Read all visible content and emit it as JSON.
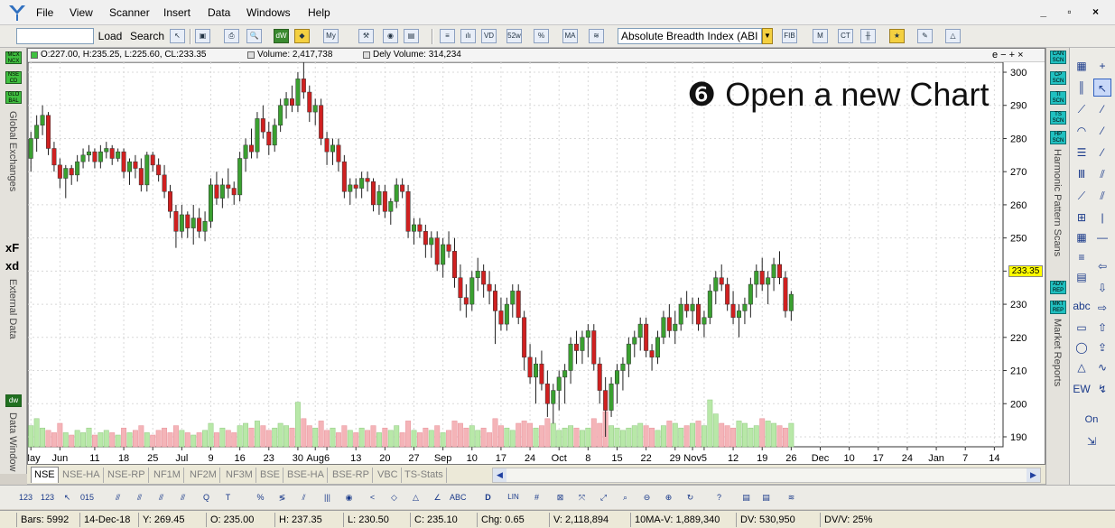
{
  "menu": {
    "items": [
      "File",
      "View",
      "Scanner",
      "Insert",
      "Data",
      "Windows",
      "Help"
    ],
    "window_controls": "_ ▫ ×"
  },
  "toolbar": {
    "load_label": "Load",
    "search_label": "Search",
    "indicator_value": "Absolute Breadth Index (ABI",
    "icons": [
      "auto-fibo",
      "pvt",
      "cow-tail",
      "star",
      "line-tools"
    ]
  },
  "left_panel": {
    "exchange_buttons": [
      "MCX NCX",
      "NSE CD",
      "GLO BAL"
    ],
    "global_exchanges_label": "Global Exchanges",
    "fx_label": "xF",
    "fd_label": "xd",
    "external_data_label": "External Data",
    "dw_button": "dw",
    "data_window_label": "Data Window"
  },
  "chart_header": {
    "ohlc": "O:227.00, H:235.25, L:225.60, CL:233.35",
    "volume": "Volume: 2,417,738",
    "dely_volume": "Dely Volume: 314,234",
    "controls": "e − + ×"
  },
  "overlay_title": "❻ Open a new Chart",
  "last_price_tag": "233.35",
  "chart_data": {
    "type": "candlestick",
    "y_axis_ticks": [
      300,
      290,
      280,
      270,
      260,
      250,
      240,
      230,
      220,
      210,
      200,
      190
    ],
    "ylim": [
      187,
      303
    ],
    "x_tick_labels": [
      {
        "label": "May",
        "i": 0
      },
      {
        "label": "Jun",
        "i": 5
      },
      {
        "label": "11",
        "i": 11
      },
      {
        "label": "18",
        "i": 16
      },
      {
        "label": "25",
        "i": 21
      },
      {
        "label": "Jul",
        "i": 26
      },
      {
        "label": "9",
        "i": 31
      },
      {
        "label": "16",
        "i": 36
      },
      {
        "label": "23",
        "i": 41
      },
      {
        "label": "30",
        "i": 46
      },
      {
        "label": "Aug",
        "i": 49
      },
      {
        "label": "6",
        "i": 51
      },
      {
        "label": "13",
        "i": 56
      },
      {
        "label": "20",
        "i": 61
      },
      {
        "label": "27",
        "i": 66
      },
      {
        "label": "Sep",
        "i": 71
      },
      {
        "label": "10",
        "i": 76
      },
      {
        "label": "17",
        "i": 81
      },
      {
        "label": "24",
        "i": 86
      },
      {
        "label": "Oct",
        "i": 91
      },
      {
        "label": "8",
        "i": 96
      },
      {
        "label": "15",
        "i": 101
      },
      {
        "label": "22",
        "i": 106
      },
      {
        "label": "29",
        "i": 111
      },
      {
        "label": "Nov",
        "i": 114
      },
      {
        "label": "5",
        "i": 116
      },
      {
        "label": "12",
        "i": 121
      },
      {
        "label": "19",
        "i": 126
      },
      {
        "label": "26",
        "i": 131
      },
      {
        "label": "Dec",
        "i": 136
      },
      {
        "label": "10",
        "i": 141
      },
      {
        "label": "17",
        "i": 146
      },
      {
        "label": "24",
        "i": 151
      },
      {
        "label": "Jan",
        "i": 156
      },
      {
        "label": "7",
        "i": 161
      },
      {
        "label": "14",
        "i": 166
      }
    ],
    "total_slots": 168,
    "candles": [
      [
        274,
        282,
        270,
        280
      ],
      [
        280,
        287,
        276,
        284
      ],
      [
        284,
        290,
        281,
        287
      ],
      [
        287,
        288,
        275,
        277
      ],
      [
        277,
        279,
        270,
        272
      ],
      [
        272,
        274,
        265,
        268
      ],
      [
        268,
        272,
        262,
        271
      ],
      [
        271,
        272,
        266,
        269
      ],
      [
        269,
        275,
        267,
        273
      ],
      [
        273,
        277,
        271,
        275
      ],
      [
        275,
        278,
        273,
        276
      ],
      [
        276,
        277,
        271,
        273
      ],
      [
        273,
        278,
        271,
        276
      ],
      [
        276,
        279,
        274,
        277
      ],
      [
        277,
        278,
        272,
        274
      ],
      [
        274,
        277,
        273,
        276
      ],
      [
        276,
        277,
        268,
        270
      ],
      [
        270,
        274,
        266,
        273
      ],
      [
        273,
        275,
        268,
        271
      ],
      [
        271,
        274,
        264,
        266
      ],
      [
        266,
        276,
        264,
        275
      ],
      [
        275,
        276,
        270,
        272
      ],
      [
        272,
        274,
        267,
        269
      ],
      [
        269,
        272,
        262,
        264
      ],
      [
        264,
        266,
        256,
        258
      ],
      [
        258,
        260,
        247,
        252
      ],
      [
        252,
        260,
        250,
        257
      ],
      [
        257,
        258,
        250,
        253
      ],
      [
        253,
        260,
        248,
        256
      ],
      [
        256,
        259,
        250,
        252
      ],
      [
        252,
        258,
        249,
        255
      ],
      [
        255,
        268,
        253,
        266
      ],
      [
        266,
        270,
        260,
        262
      ],
      [
        262,
        268,
        259,
        266
      ],
      [
        266,
        271,
        262,
        265
      ],
      [
        265,
        267,
        260,
        263
      ],
      [
        263,
        276,
        261,
        274
      ],
      [
        274,
        280,
        270,
        278
      ],
      [
        278,
        283,
        274,
        276
      ],
      [
        276,
        288,
        274,
        286
      ],
      [
        286,
        290,
        280,
        282
      ],
      [
        282,
        285,
        275,
        278
      ],
      [
        278,
        286,
        276,
        284
      ],
      [
        284,
        292,
        282,
        290
      ],
      [
        290,
        294,
        286,
        292
      ],
      [
        292,
        296,
        288,
        290
      ],
      [
        290,
        300,
        288,
        298
      ],
      [
        298,
        304,
        292,
        294
      ],
      [
        294,
        296,
        285,
        288
      ],
      [
        288,
        292,
        284,
        290
      ],
      [
        290,
        292,
        278,
        280
      ],
      [
        280,
        282,
        272,
        276
      ],
      [
        276,
        280,
        272,
        278
      ],
      [
        278,
        280,
        270,
        273
      ],
      [
        273,
        275,
        262,
        264
      ],
      [
        264,
        268,
        260,
        266
      ],
      [
        266,
        268,
        262,
        265
      ],
      [
        265,
        270,
        262,
        268
      ],
      [
        268,
        270,
        264,
        267
      ],
      [
        267,
        268,
        258,
        260
      ],
      [
        260,
        266,
        257,
        264
      ],
      [
        264,
        266,
        256,
        258
      ],
      [
        258,
        262,
        254,
        261
      ],
      [
        261,
        268,
        259,
        266
      ],
      [
        266,
        268,
        262,
        264
      ],
      [
        264,
        266,
        250,
        252
      ],
      [
        252,
        256,
        248,
        254
      ],
      [
        254,
        256,
        250,
        252
      ],
      [
        252,
        254,
        244,
        248
      ],
      [
        248,
        252,
        244,
        250
      ],
      [
        250,
        252,
        240,
        242
      ],
      [
        242,
        250,
        238,
        248
      ],
      [
        248,
        252,
        244,
        246
      ],
      [
        246,
        250,
        235,
        238
      ],
      [
        238,
        242,
        228,
        232
      ],
      [
        232,
        236,
        226,
        230
      ],
      [
        230,
        240,
        228,
        238
      ],
      [
        238,
        244,
        234,
        240
      ],
      [
        240,
        242,
        232,
        236
      ],
      [
        236,
        240,
        230,
        234
      ],
      [
        234,
        236,
        218,
        228
      ],
      [
        228,
        232,
        222,
        224
      ],
      [
        224,
        232,
        222,
        230
      ],
      [
        230,
        236,
        226,
        234
      ],
      [
        234,
        236,
        224,
        226
      ],
      [
        226,
        228,
        210,
        214
      ],
      [
        214,
        218,
        206,
        208
      ],
      [
        208,
        214,
        200,
        212
      ],
      [
        212,
        216,
        204,
        206
      ],
      [
        206,
        210,
        196,
        200
      ],
      [
        200,
        206,
        194,
        204
      ],
      [
        204,
        210,
        198,
        208
      ],
      [
        208,
        212,
        200,
        210
      ],
      [
        210,
        220,
        206,
        218
      ],
      [
        218,
        222,
        212,
        216
      ],
      [
        216,
        222,
        212,
        220
      ],
      [
        220,
        224,
        214,
        222
      ],
      [
        222,
        224,
        210,
        212
      ],
      [
        212,
        214,
        200,
        204
      ],
      [
        204,
        208,
        190,
        198
      ],
      [
        198,
        208,
        196,
        206
      ],
      [
        206,
        212,
        200,
        210
      ],
      [
        210,
        214,
        204,
        212
      ],
      [
        212,
        220,
        208,
        218
      ],
      [
        218,
        222,
        214,
        220
      ],
      [
        220,
        226,
        216,
        224
      ],
      [
        224,
        226,
        214,
        216
      ],
      [
        216,
        218,
        210,
        214
      ],
      [
        214,
        222,
        212,
        220
      ],
      [
        220,
        228,
        218,
        226
      ],
      [
        226,
        230,
        220,
        222
      ],
      [
        222,
        228,
        218,
        224
      ],
      [
        224,
        232,
        222,
        230
      ],
      [
        230,
        234,
        226,
        228
      ],
      [
        228,
        232,
        224,
        230
      ],
      [
        230,
        232,
        222,
        224
      ],
      [
        224,
        228,
        220,
        226
      ],
      [
        226,
        236,
        224,
        234
      ],
      [
        234,
        240,
        230,
        238
      ],
      [
        238,
        242,
        234,
        236
      ],
      [
        236,
        238,
        228,
        230
      ],
      [
        230,
        234,
        224,
        226
      ],
      [
        226,
        230,
        220,
        228
      ],
      [
        228,
        232,
        224,
        230
      ],
      [
        230,
        238,
        226,
        236
      ],
      [
        236,
        242,
        232,
        240
      ],
      [
        240,
        244,
        234,
        236
      ],
      [
        236,
        240,
        230,
        238
      ],
      [
        238,
        244,
        234,
        242
      ],
      [
        242,
        246,
        236,
        238
      ],
      [
        238,
        240,
        226,
        228
      ],
      [
        228,
        234,
        225,
        233
      ]
    ],
    "volumes": [
      0.45,
      0.6,
      0.4,
      0.35,
      0.3,
      0.5,
      0.3,
      0.25,
      0.35,
      0.3,
      0.4,
      0.25,
      0.3,
      0.35,
      0.3,
      0.25,
      0.4,
      0.3,
      0.35,
      0.45,
      0.3,
      0.25,
      0.35,
      0.4,
      0.3,
      0.45,
      0.35,
      0.3,
      0.25,
      0.3,
      0.35,
      0.5,
      0.3,
      0.4,
      0.35,
      0.3,
      0.45,
      0.5,
      0.4,
      0.55,
      0.45,
      0.35,
      0.4,
      0.5,
      0.45,
      0.4,
      0.95,
      0.6,
      0.45,
      0.4,
      0.55,
      0.35,
      0.4,
      0.3,
      0.45,
      0.35,
      0.3,
      0.4,
      0.35,
      0.45,
      0.3,
      0.4,
      0.35,
      0.45,
      0.3,
      0.55,
      0.35,
      0.3,
      0.4,
      0.35,
      0.45,
      0.3,
      0.35,
      0.55,
      0.5,
      0.4,
      0.45,
      0.35,
      0.4,
      0.3,
      0.6,
      0.45,
      0.4,
      0.35,
      0.5,
      0.55,
      0.5,
      0.4,
      0.45,
      0.6,
      0.5,
      0.35,
      0.4,
      0.45,
      0.4,
      0.35,
      0.4,
      0.6,
      0.5,
      0.75,
      0.45,
      0.4,
      0.35,
      0.4,
      0.45,
      0.5,
      0.45,
      0.4,
      0.35,
      0.45,
      0.55,
      0.5,
      0.4,
      0.45,
      0.5,
      0.55,
      0.45,
      1.0,
      0.7,
      0.5,
      0.45,
      0.4,
      0.55,
      0.5,
      0.4,
      0.45,
      0.6,
      0.55,
      0.5,
      0.45,
      0.4,
      0.5,
      0.45,
      0.4,
      0.55,
      0.7,
      0.5
    ]
  },
  "tabs": [
    "NSE",
    "NSE-HA",
    "NSE-RP",
    "NF1M",
    "NF2M",
    "NF3M",
    "BSE",
    "BSE-HA",
    "BSE-RP",
    "VBC",
    "TS-Stats"
  ],
  "scan_panel": {
    "buttons": [
      "CAN SCN",
      "CP SCN",
      "TI SCN",
      "TS SCN",
      "HP SCN"
    ],
    "harmonic_label": "Harmonic Pattern Scans",
    "report_buttons": [
      "ADV REP",
      "MKT REP"
    ],
    "market_reports_label": "Market Reports"
  },
  "draw_tools": {
    "on_label": "On",
    "abc_label": "abc"
  },
  "status": {
    "bars": "Bars: 5992",
    "date": "14-Dec-18",
    "y": "Y: 269.45",
    "open": "O: 235.00",
    "high": "H: 237.35",
    "low": "L: 230.50",
    "close": "C: 235.10",
    "chg": "Chg: 0.65",
    "volume": "V: 2,118,894",
    "ma_volume": "10MA-V: 1,889,340",
    "dv": "DV: 530,950",
    "dvv": "DV/V: 25%"
  },
  "colors": {
    "bull": "#3aa030",
    "bear": "#d02020",
    "bull_vol": "#b8e8a8",
    "bear_vol": "#f4b4b8",
    "scan_btn": "#20c0c0",
    "price_tag": "#ffff00"
  }
}
